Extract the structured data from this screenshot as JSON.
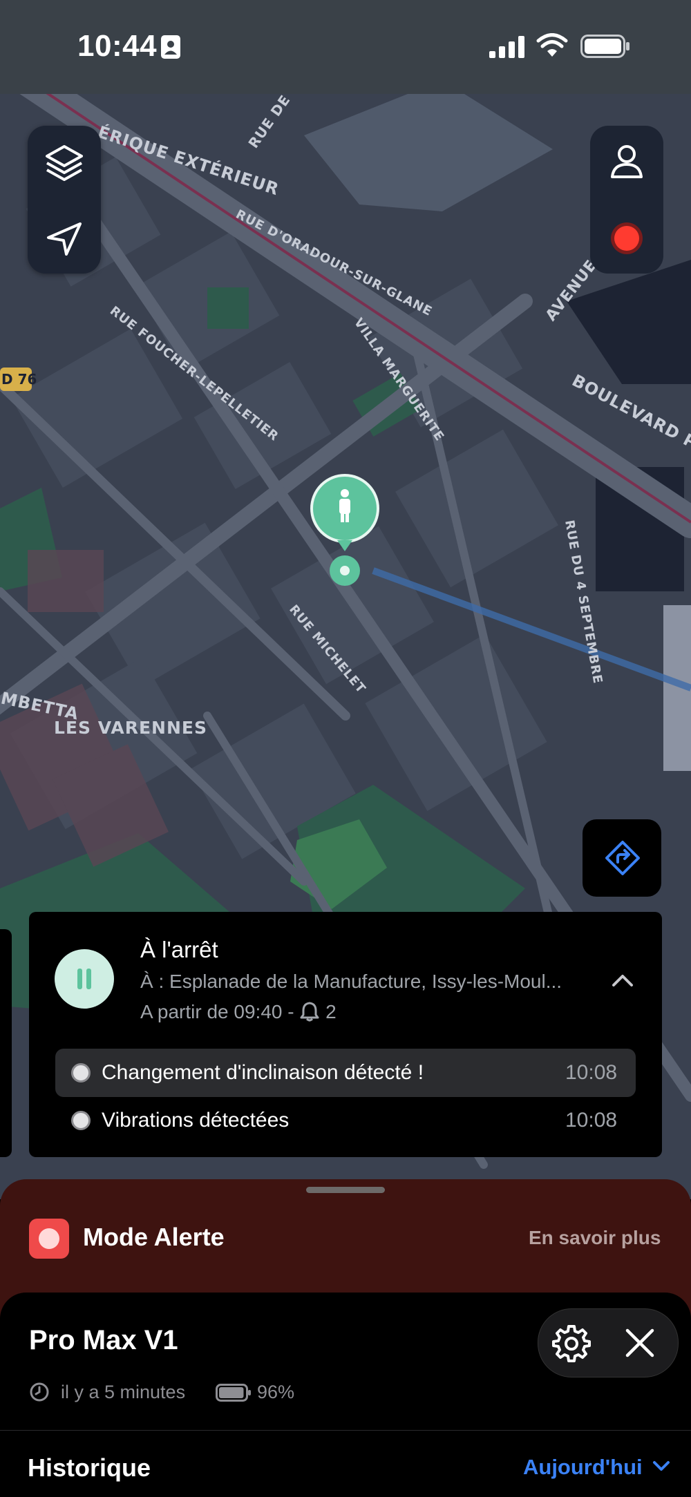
{
  "status_bar": {
    "time": "10:44"
  },
  "map": {
    "labels": {
      "street_1": "ÉRIQUE EXTÉRIEUR",
      "street_2": "RUE DE D",
      "street_3": "RUE D'ORADOUR-SUR-GLANE",
      "street_4": "VILLA MARGUERITE",
      "street_5": "RUE FOUCHER-LEPELLETIER",
      "street_6": "BOULEVARD PÉR",
      "street_7": "AVENUE",
      "street_8": "RUE DU 4 SEPTEMBRE",
      "street_9": "RUE MICHELET",
      "street_10": "MBETTA",
      "district": "LES VARENNES",
      "road_badge": "D 76"
    },
    "accent": "#5dc39d"
  },
  "controls": {
    "left": [
      "layers-icon",
      "navigation-arrow-icon"
    ],
    "right": [
      "person-icon",
      "record-icon"
    ],
    "directions": "directions-icon"
  },
  "status_card": {
    "title": "À l'arrêt",
    "address": "À : Esplanade de la Manufacture, Issy-les-Moul...",
    "since": "A partir de 09:40 - ",
    "alert_count": "2",
    "events": [
      {
        "label": "Changement d'inclinaison détecté !",
        "time": "10:08"
      },
      {
        "label": "Vibrations détectées",
        "time": "10:08"
      }
    ]
  },
  "alert_mode": {
    "title": "Mode Alerte",
    "learn_more": "En savoir plus"
  },
  "device": {
    "name": "Pro Max V1",
    "last_seen": "il y a 5 minutes",
    "battery": "96%",
    "battery_level": 0.96
  },
  "history": {
    "title": "Historique",
    "period": "Aujourd'hui"
  }
}
